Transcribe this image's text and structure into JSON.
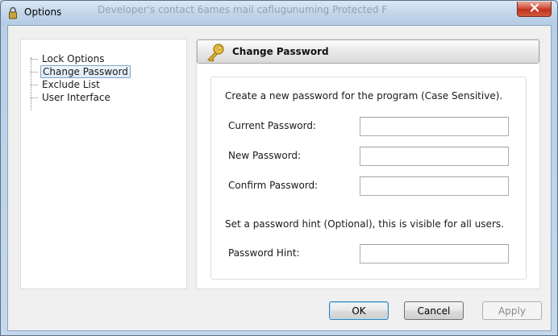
{
  "window": {
    "title": "Options",
    "background_text": "Developer's contact 6ames mail  caflugunuming  Protected F"
  },
  "tree": {
    "items": [
      {
        "label": "Lock Options",
        "selected": false
      },
      {
        "label": "Change Password",
        "selected": true
      },
      {
        "label": "Exclude List",
        "selected": false
      },
      {
        "label": "User Interface",
        "selected": false
      }
    ]
  },
  "panel": {
    "title": "Change Password",
    "icon": "key-icon",
    "intro": "Create a new password for the program (Case Sensitive).",
    "current_password_label": "Current Password:",
    "current_password_value": "",
    "new_password_label": "New Password:",
    "new_password_value": "",
    "confirm_password_label": "Confirm Password:",
    "confirm_password_value": "",
    "hint_intro": "Set a password hint (Optional), this is visible for all users.",
    "hint_label": "Password Hint:",
    "hint_value": ""
  },
  "buttons": {
    "ok": "OK",
    "cancel": "Cancel",
    "apply": "Apply"
  },
  "colors": {
    "accent": "#7da2ce",
    "close_red": "#c0321e",
    "key_gold": "#e0b030"
  }
}
